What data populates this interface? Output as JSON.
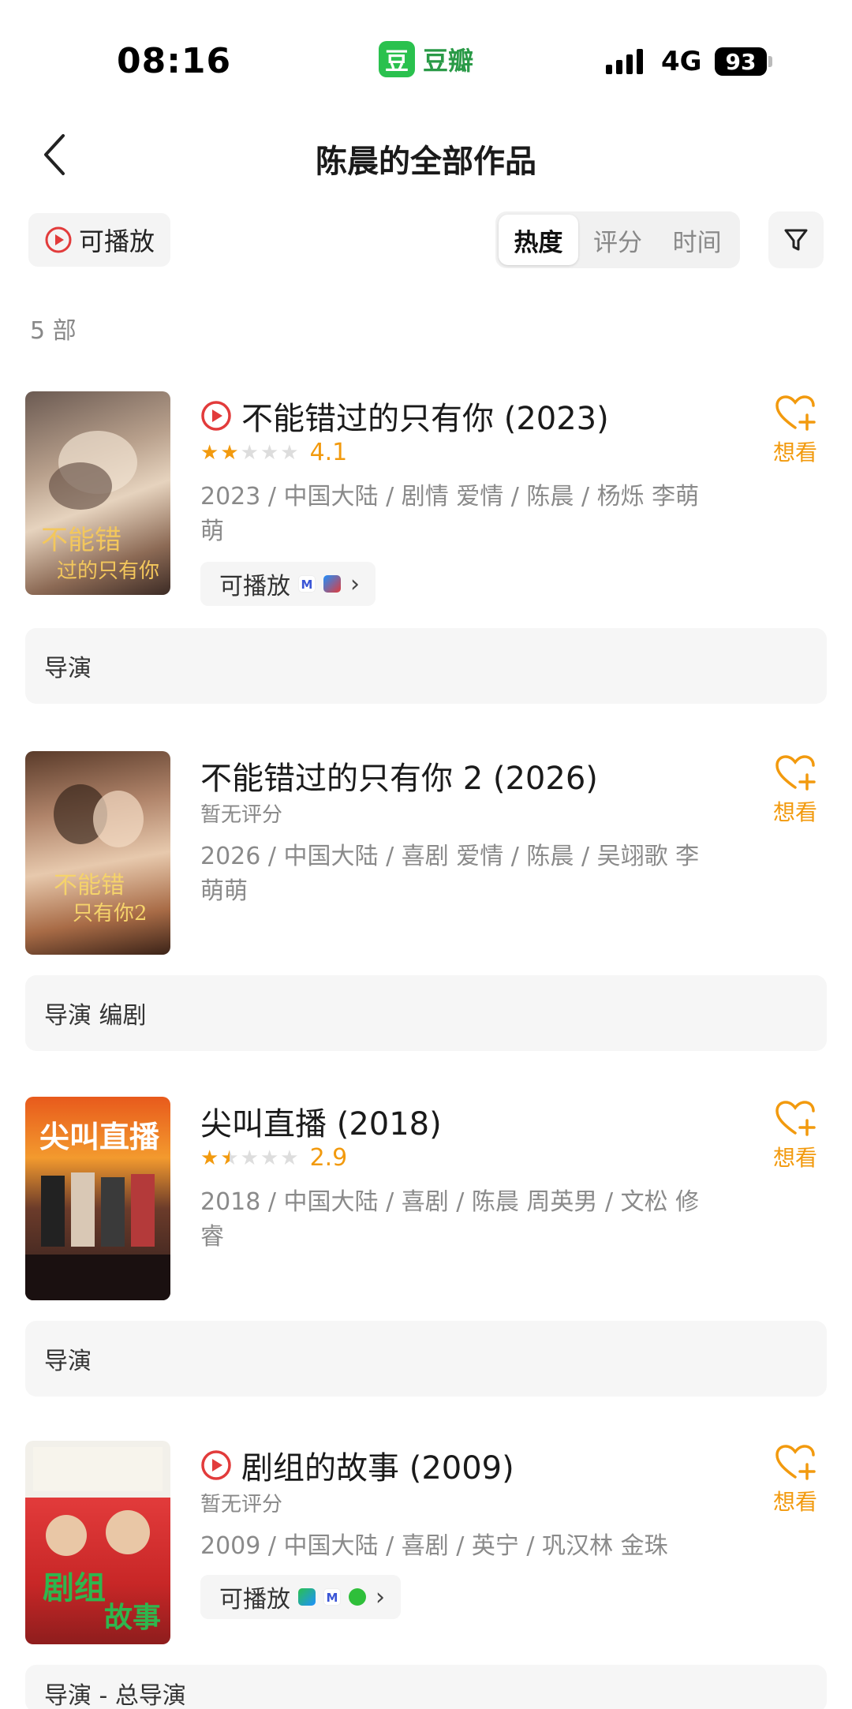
{
  "status_bar": {
    "time": "08:16",
    "app_logo": "豆",
    "app_name": "豆瓣",
    "network": "4G",
    "battery": "93"
  },
  "header": {
    "title": "陈晨的全部作品"
  },
  "filters": {
    "playable_label": "可播放",
    "sort_tabs": [
      "热度",
      "评分",
      "时间"
    ],
    "active_sort": "热度",
    "count_label": "5 部"
  },
  "colors": {
    "accent_orange": "#f29a0e",
    "play_red": "#e23b3b",
    "douban_green": "#2ac14e"
  },
  "movies": [
    {
      "playable": true,
      "title": "不能错过的只有你 (2023)",
      "stars": 2,
      "score": "4.1",
      "rating_text": "",
      "meta": "2023 / 中国大陆 / 剧情 爱情 / 陈晨 / 杨烁 李萌萌",
      "play_chip": "可播放",
      "platforms": [
        "youku-icon",
        "tencent-video-icon"
      ],
      "want_label": "想看",
      "role": "导演"
    },
    {
      "playable": false,
      "title": "不能错过的只有你 2 (2026)",
      "stars": 0,
      "score": "",
      "rating_text": "暂无评分",
      "meta": "2026 / 中国大陆 / 喜剧 爱情 / 陈晨 / 吴翊歌 李萌萌",
      "play_chip": "",
      "platforms": [],
      "want_label": "想看",
      "role": "导演 编剧"
    },
    {
      "playable": false,
      "title": "尖叫直播 (2018)",
      "stars": 1.5,
      "score": "2.9",
      "rating_text": "",
      "meta": "2018 / 中国大陆 / 喜剧 / 陈晨 周英男 / 文松 修睿",
      "play_chip": "",
      "platforms": [],
      "want_label": "想看",
      "role": "导演"
    },
    {
      "playable": true,
      "title": "剧组的故事 (2009)",
      "stars": 0,
      "score": "",
      "rating_text": "暂无评分",
      "meta": "2009 / 中国大陆 / 喜剧 / 英宁 / 巩汉林 金珠",
      "play_chip": "可播放",
      "platforms": [
        "tencent-play-icon",
        "youku-icon",
        "iqiyi-icon"
      ],
      "want_label": "想看",
      "role": "导演 - 总导演"
    }
  ]
}
